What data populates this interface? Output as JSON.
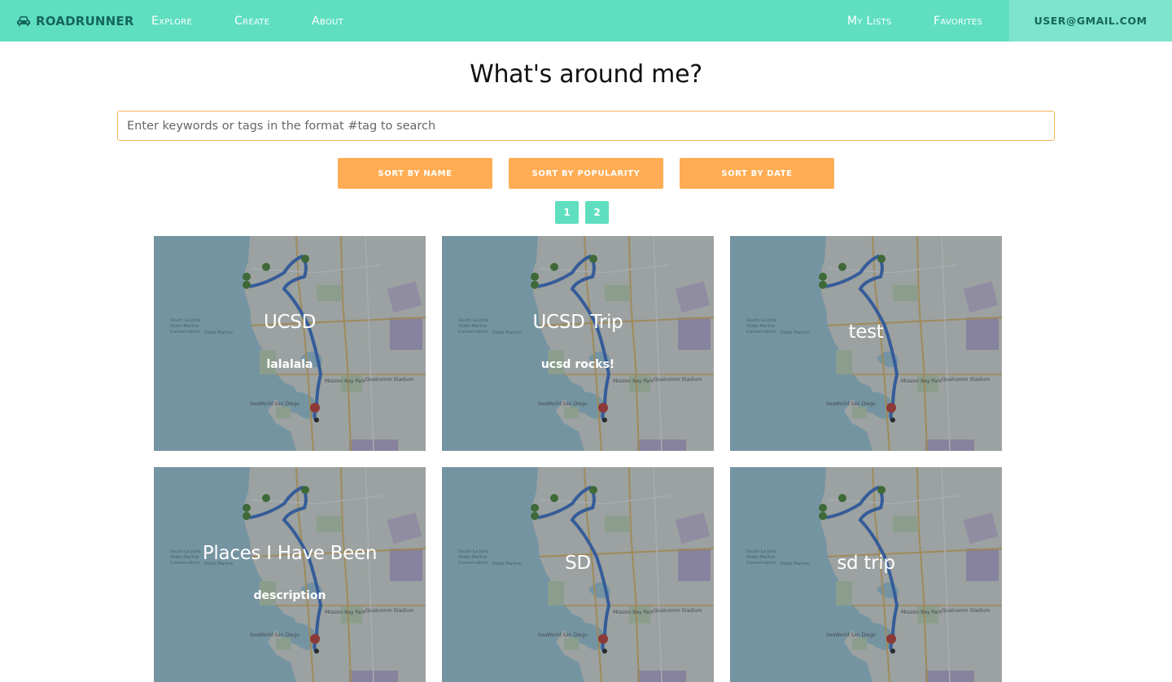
{
  "nav": {
    "brand": "ROADRUNNER",
    "links": [
      "Explore",
      "Create",
      "About"
    ],
    "right_links": [
      "My Lists",
      "Favorites"
    ],
    "user": "USER@GMAIL.COM"
  },
  "page": {
    "title": "What's around me?",
    "search_placeholder": "Enter keywords or tags in the format #tag to search"
  },
  "sort_buttons": [
    "SORT BY NAME",
    "SORT BY POPULARITY",
    "SORT BY DATE"
  ],
  "pagination": [
    "1",
    "2"
  ],
  "cards": [
    {
      "title": "UCSD",
      "description": "lalalala"
    },
    {
      "title": "UCSD Trip",
      "description": "ucsd rocks!"
    },
    {
      "title": "test",
      "description": ""
    },
    {
      "title": "Places I Have Been",
      "description": "description"
    },
    {
      "title": "SD",
      "description": ""
    },
    {
      "title": "sd trip",
      "description": ""
    }
  ],
  "colors": {
    "navbar": "#5fdfc0",
    "brand_text": "#15665a",
    "accent_orange": "#ffad55",
    "search_border": "#f4b25a"
  },
  "icons": {
    "brand": "car-icon"
  }
}
